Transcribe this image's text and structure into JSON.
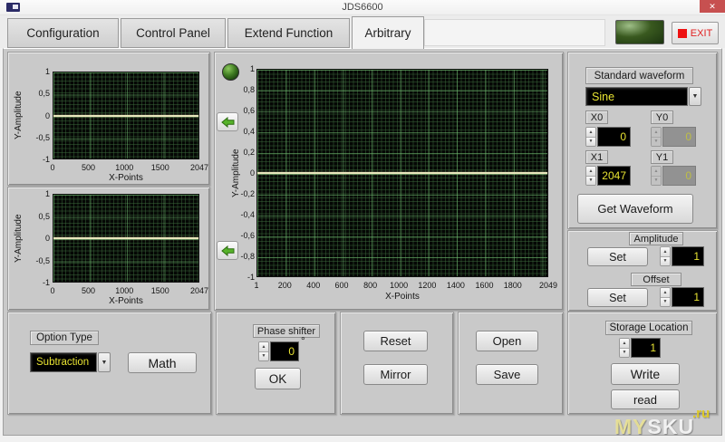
{
  "window": {
    "title": "JDS6600",
    "close_glyph": "✕"
  },
  "tabs": {
    "items": [
      {
        "label": "Configuration"
      },
      {
        "label": "Control Panel"
      },
      {
        "label": "Extend Function"
      },
      {
        "label": "Arbitrary"
      }
    ],
    "active": "Arbitrary"
  },
  "header": {
    "exit_label": "EXIT"
  },
  "graphs": {
    "left_top": {
      "type": "line",
      "ylabel": "Y-Amplitude",
      "xlabel": "X-Points",
      "x_range": [
        0,
        2047
      ],
      "y_range": [
        -1,
        1
      ],
      "line_value": 0,
      "y_ticks": [
        {
          "label": "1",
          "pos": 0
        },
        {
          "label": "0,5",
          "pos": 25
        },
        {
          "label": "0",
          "pos": 50
        },
        {
          "label": "-0,5",
          "pos": 75
        },
        {
          "label": "-1",
          "pos": 100
        }
      ],
      "x_ticks": [
        {
          "label": "0",
          "pos": 0
        },
        {
          "label": "500",
          "pos": 24.4
        },
        {
          "label": "1000",
          "pos": 48.9
        },
        {
          "label": "1500",
          "pos": 73.3
        },
        {
          "label": "2047",
          "pos": 100
        }
      ]
    },
    "left_bottom": {
      "type": "line",
      "ylabel": "Y-Amplitude",
      "xlabel": "X-Points",
      "x_range": [
        0,
        2047
      ],
      "y_range": [
        -1,
        1
      ],
      "line_value": 0,
      "y_ticks": [
        {
          "label": "1",
          "pos": 0
        },
        {
          "label": "0,5",
          "pos": 25
        },
        {
          "label": "0",
          "pos": 50
        },
        {
          "label": "-0,5",
          "pos": 75
        },
        {
          "label": "-1",
          "pos": 100
        }
      ],
      "x_ticks": [
        {
          "label": "0",
          "pos": 0
        },
        {
          "label": "500",
          "pos": 24.4
        },
        {
          "label": "1000",
          "pos": 48.9
        },
        {
          "label": "1500",
          "pos": 73.3
        },
        {
          "label": "2047",
          "pos": 100
        }
      ]
    },
    "center": {
      "type": "line",
      "ylabel": "Y-Amplitude",
      "xlabel": "X-Points",
      "x_range": [
        1,
        2049
      ],
      "y_range": [
        -1,
        1
      ],
      "line_value": 0,
      "y_ticks": [
        {
          "label": "1",
          "pos": 0
        },
        {
          "label": "0,8",
          "pos": 10
        },
        {
          "label": "0,6",
          "pos": 20
        },
        {
          "label": "0,4",
          "pos": 30
        },
        {
          "label": "0,2",
          "pos": 40
        },
        {
          "label": "0",
          "pos": 50
        },
        {
          "label": "-0,2",
          "pos": 60
        },
        {
          "label": "-0,4",
          "pos": 70
        },
        {
          "label": "-0,6",
          "pos": 80
        },
        {
          "label": "-0,8",
          "pos": 90
        },
        {
          "label": "-1",
          "pos": 100
        }
      ],
      "x_ticks": [
        {
          "label": "1",
          "pos": 0
        },
        {
          "label": "200",
          "pos": 9.7
        },
        {
          "label": "400",
          "pos": 19.5
        },
        {
          "label": "600",
          "pos": 29.2
        },
        {
          "label": "800",
          "pos": 39.0
        },
        {
          "label": "1000",
          "pos": 48.8
        },
        {
          "label": "1200",
          "pos": 58.5
        },
        {
          "label": "1400",
          "pos": 68.3
        },
        {
          "label": "1600",
          "pos": 78.1
        },
        {
          "label": "1800",
          "pos": 87.8
        },
        {
          "label": "2049",
          "pos": 100
        }
      ]
    }
  },
  "right_panel": {
    "standard_waveform": {
      "label": "Standard waveform",
      "value": "Sine"
    },
    "x0": {
      "label": "X0",
      "value": "0"
    },
    "y0": {
      "label": "Y0",
      "value": "0"
    },
    "x1": {
      "label": "X1",
      "value": "2047"
    },
    "y1": {
      "label": "Y1",
      "value": "0"
    },
    "get_waveform_label": "Get Waveform",
    "amplitude": {
      "label": "Amplitude",
      "button": "Set",
      "value": "1"
    },
    "offset": {
      "label": "Offset",
      "button": "Set",
      "value": "1"
    },
    "storage": {
      "label": "Storage Location",
      "value": "1",
      "write_label": "Write",
      "read_label": "read"
    }
  },
  "bottom_panel": {
    "option_type": {
      "label": "Option Type",
      "value": "Subtraction",
      "math_label": "Math"
    },
    "phase": {
      "label": "Phase shifter",
      "value": "0",
      "unit": "°",
      "ok_label": "OK"
    },
    "reset_label": "Reset",
    "mirror_label": "Mirror",
    "open_label": "Open",
    "save_label": "Save"
  },
  "watermark": {
    "main": "MY",
    "main2": "SKU",
    "suffix": ".ru"
  },
  "colors": {
    "value_yellow": "#e8e332",
    "plot_line": "#e9e6bd",
    "led_green": "#407c22",
    "exit_red": "#ee1111"
  }
}
